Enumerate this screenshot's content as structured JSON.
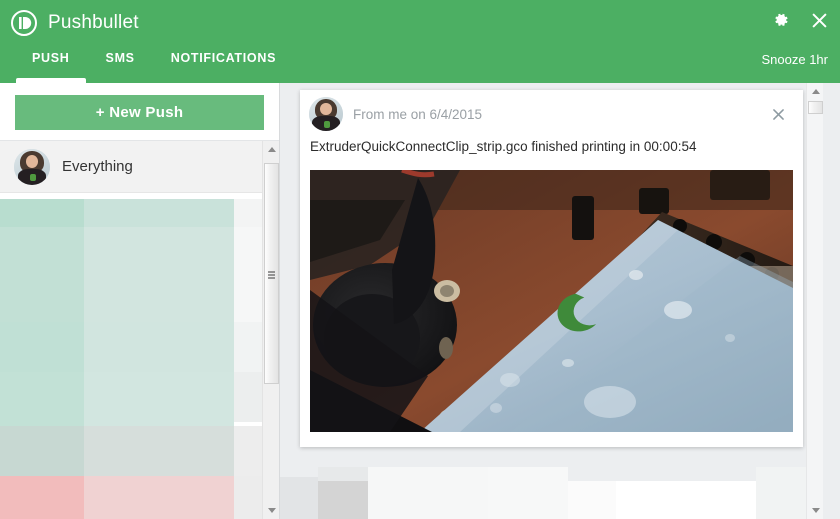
{
  "window": {
    "app_title": "Pushbullet",
    "brand_color": "#4caf63",
    "logo_icon": "pushbullet-logo-icon"
  },
  "header": {
    "settings_icon": "gear-icon",
    "close_icon": "close-icon",
    "snooze_label": "Snooze 1hr",
    "tabs": [
      {
        "label": "PUSH",
        "active": true
      },
      {
        "label": "SMS",
        "active": false
      },
      {
        "label": "NOTIFICATIONS",
        "active": false
      }
    ]
  },
  "sidebar": {
    "new_push_label": "+ New Push",
    "channels": [
      {
        "label": "Everything",
        "avatar": "user-avatar",
        "selected": true
      }
    ],
    "scrollbar": {
      "up_arrow_icon": "scroll-up-arrow-icon",
      "down_arrow_icon": "scroll-down-arrow-icon",
      "grip_icon": "scrollbar-grip-icon"
    }
  },
  "main": {
    "push_card": {
      "avatar": "user-avatar",
      "from_text": "From me on 6/4/2015",
      "close_icon": "close-icon",
      "message": "ExtruderQuickConnectClip_strip.gco finished printing in 00:00:54",
      "photo_alt": "3D printer bed with green printed clip"
    },
    "scrollbar": {
      "up_arrow_icon": "scroll-up-arrow-icon",
      "down_arrow_icon": "scroll-down-arrow-icon"
    }
  }
}
